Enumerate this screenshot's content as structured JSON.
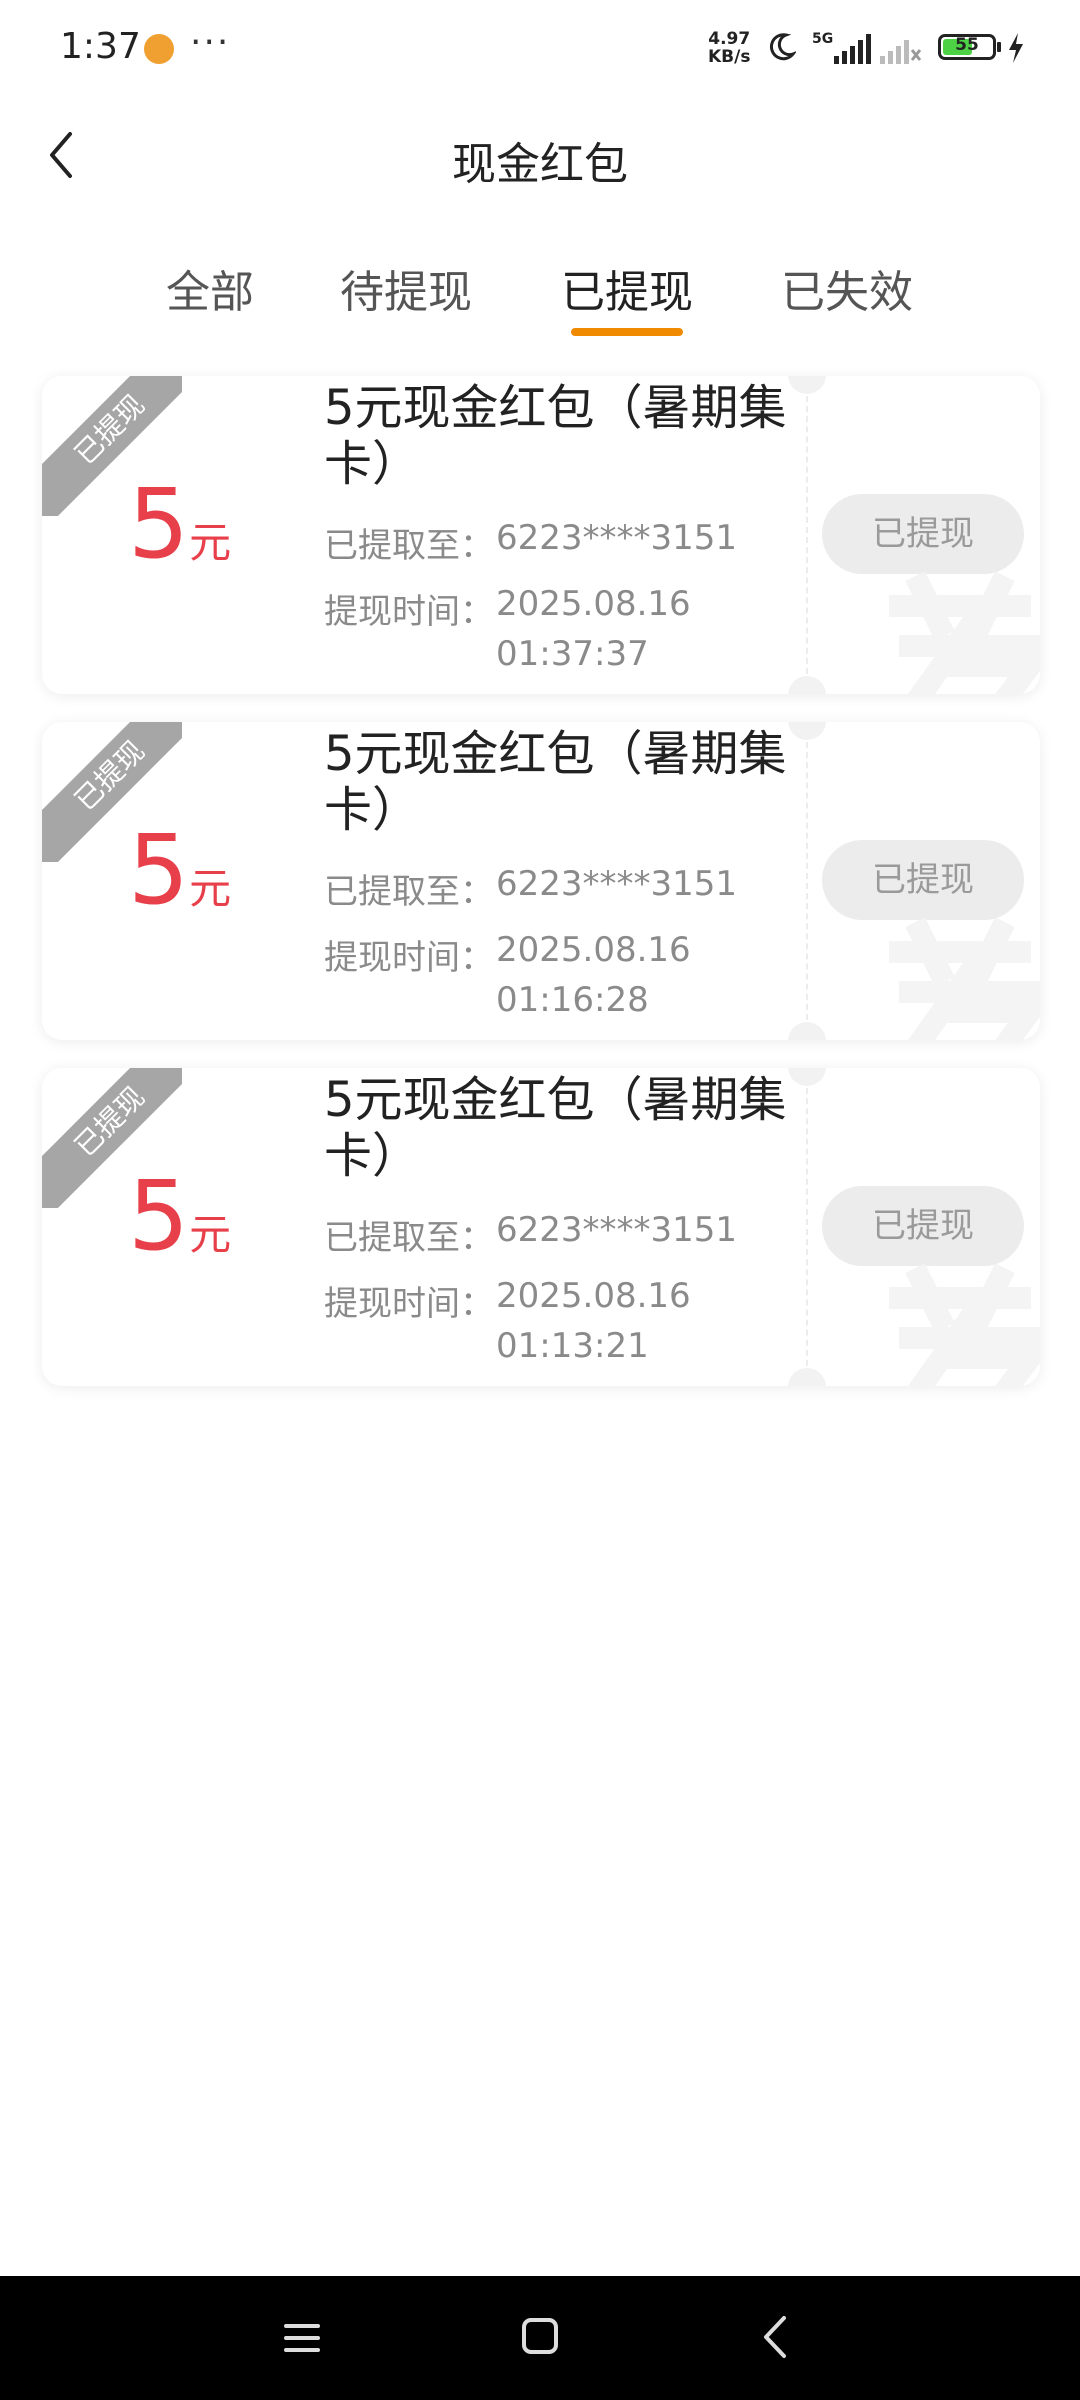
{
  "status_bar": {
    "time": "1:37",
    "more": "···",
    "net_speed_value": "4.97",
    "net_speed_unit": "KB/s",
    "network": "5G",
    "battery": "55"
  },
  "header": {
    "title": "现金红包",
    "back_icon": "chevron-left-icon"
  },
  "tabs": [
    {
      "label": "全部",
      "active": false
    },
    {
      "label": "待提现",
      "active": false
    },
    {
      "label": "已提现",
      "active": true
    },
    {
      "label": "已失效",
      "active": false
    }
  ],
  "colors": {
    "accent": "#f08a00",
    "amount": "#e8404a",
    "ribbon": "#a6a6a6",
    "muted_text": "#8a8a8a"
  },
  "cards": [
    {
      "ribbon": "已提现",
      "amount": "5",
      "unit": "元",
      "title": "5元现金红包（暑期集卡）",
      "dest_label": "已提取至：",
      "dest_value": "6223****3151",
      "time_label": "提现时间：",
      "time_date": "2025.08.16",
      "time_clock": "01:37:37",
      "button": "已提现"
    },
    {
      "ribbon": "已提现",
      "amount": "5",
      "unit": "元",
      "title": "5元现金红包（暑期集卡）",
      "dest_label": "已提取至：",
      "dest_value": "6223****3151",
      "time_label": "提现时间：",
      "time_date": "2025.08.16",
      "time_clock": "01:16:28",
      "button": "已提现"
    },
    {
      "ribbon": "已提现",
      "amount": "5",
      "unit": "元",
      "title": "5元现金红包（暑期集卡）",
      "dest_label": "已提取至：",
      "dest_value": "6223****3151",
      "time_label": "提现时间：",
      "time_date": "2025.08.16",
      "time_clock": "01:13:21",
      "button": "已提现"
    }
  ],
  "nav_bar": {
    "menu_icon": "menu-icon",
    "home_icon": "home-icon",
    "back_icon": "back-icon"
  }
}
